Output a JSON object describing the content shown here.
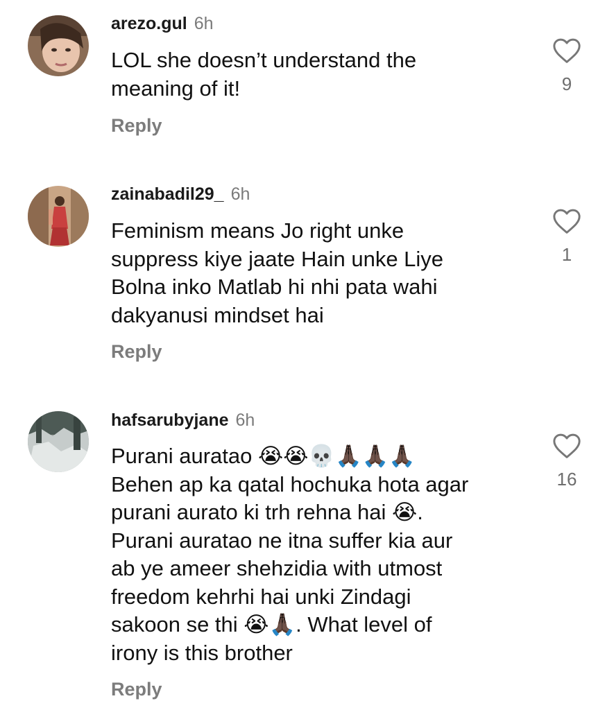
{
  "comments": [
    {
      "username": "arezo.gul",
      "time": "6h",
      "lines": [
        "LOL she doesn’t understand the",
        "meaning of it!"
      ],
      "likes": "9",
      "reply_label": "Reply",
      "avatar_icon": "user-avatar-icon"
    },
    {
      "username": "zainabadil29_",
      "time": "6h",
      "lines": [
        "Feminism means Jo right unke",
        "suppress kiye jaate Hain unke Liye",
        "Bolna inko Matlab hi nhi pata wahi",
        "dakyanusi mindset hai"
      ],
      "likes": "1",
      "reply_label": "Reply",
      "avatar_icon": "user-avatar-icon"
    },
    {
      "username": "hafsarubyjane",
      "time": "6h",
      "lines": [
        "Purani auratao 😭😭💀🙏🏿🙏🏿🙏🏿",
        "Behen ap ka qatal hochuka hota agar",
        "purani aurato ki trh rehna hai 😭.",
        "Purani auratao ne itna suffer kia aur",
        "ab ye ameer shehzidia with utmost",
        "freedom kehrhi hai unki Zindagi",
        "sakoon se thi 😭🙏🏿. What level of",
        "irony is this brother"
      ],
      "likes": "16",
      "reply_label": "Reply",
      "avatar_icon": "user-avatar-icon"
    }
  ]
}
